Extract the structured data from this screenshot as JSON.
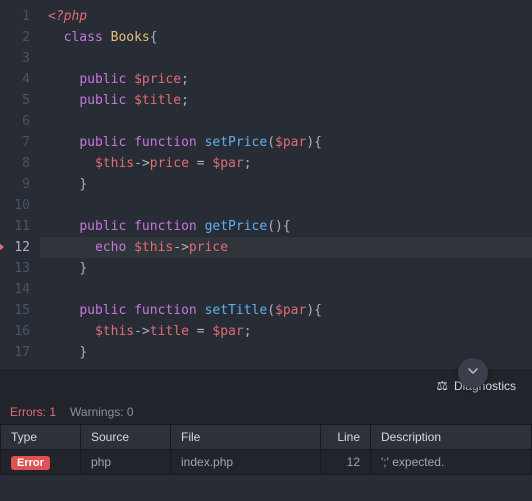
{
  "editor": {
    "lines": [
      {
        "n": 1,
        "indent": 0,
        "tokens": [
          {
            "t": "<?php",
            "c": "t-php"
          }
        ]
      },
      {
        "n": 2,
        "indent": 1,
        "tokens": [
          {
            "t": "class ",
            "c": "t-kw"
          },
          {
            "t": "Books",
            "c": "t-cls"
          },
          {
            "t": "{",
            "c": "t-punc"
          }
        ]
      },
      {
        "n": 3,
        "indent": 0,
        "tokens": []
      },
      {
        "n": 4,
        "indent": 2,
        "tokens": [
          {
            "t": "public ",
            "c": "t-kw"
          },
          {
            "t": "$price",
            "c": "t-var"
          },
          {
            "t": ";",
            "c": "t-punc"
          }
        ]
      },
      {
        "n": 5,
        "indent": 2,
        "tokens": [
          {
            "t": "public ",
            "c": "t-kw"
          },
          {
            "t": "$title",
            "c": "t-var"
          },
          {
            "t": ";",
            "c": "t-punc"
          }
        ]
      },
      {
        "n": 6,
        "indent": 0,
        "tokens": []
      },
      {
        "n": 7,
        "indent": 2,
        "tokens": [
          {
            "t": "public ",
            "c": "t-kw"
          },
          {
            "t": "function ",
            "c": "t-kw"
          },
          {
            "t": "setPrice",
            "c": "t-fn"
          },
          {
            "t": "(",
            "c": "t-punc"
          },
          {
            "t": "$par",
            "c": "t-var"
          },
          {
            "t": "){",
            "c": "t-punc"
          }
        ]
      },
      {
        "n": 8,
        "indent": 3,
        "tokens": [
          {
            "t": "$this",
            "c": "t-this"
          },
          {
            "t": "->",
            "c": "t-op"
          },
          {
            "t": "price",
            "c": "t-prop"
          },
          {
            "t": " = ",
            "c": "t-op"
          },
          {
            "t": "$par",
            "c": "t-var"
          },
          {
            "t": ";",
            "c": "t-punc"
          }
        ]
      },
      {
        "n": 9,
        "indent": 2,
        "tokens": [
          {
            "t": "}",
            "c": "t-punc"
          }
        ]
      },
      {
        "n": 10,
        "indent": 0,
        "tokens": []
      },
      {
        "n": 11,
        "indent": 2,
        "tokens": [
          {
            "t": "public ",
            "c": "t-kw"
          },
          {
            "t": "function ",
            "c": "t-kw"
          },
          {
            "t": "getPrice",
            "c": "t-fn"
          },
          {
            "t": "(){",
            "c": "t-punc"
          }
        ]
      },
      {
        "n": 12,
        "indent": 3,
        "current": true,
        "marker": true,
        "tokens": [
          {
            "t": "echo ",
            "c": "t-echo"
          },
          {
            "t": "$this",
            "c": "t-this"
          },
          {
            "t": "->",
            "c": "t-op"
          },
          {
            "t": "price",
            "c": "t-prop"
          }
        ]
      },
      {
        "n": 13,
        "indent": 2,
        "tokens": [
          {
            "t": "}",
            "c": "t-punc"
          }
        ]
      },
      {
        "n": 14,
        "indent": 0,
        "tokens": []
      },
      {
        "n": 15,
        "indent": 2,
        "tokens": [
          {
            "t": "public ",
            "c": "t-kw"
          },
          {
            "t": "function ",
            "c": "t-kw"
          },
          {
            "t": "setTitle",
            "c": "t-fn"
          },
          {
            "t": "(",
            "c": "t-punc"
          },
          {
            "t": "$par",
            "c": "t-var"
          },
          {
            "t": "){",
            "c": "t-punc"
          }
        ]
      },
      {
        "n": 16,
        "indent": 3,
        "tokens": [
          {
            "t": "$this",
            "c": "t-this"
          },
          {
            "t": "->",
            "c": "t-op"
          },
          {
            "t": "title",
            "c": "t-prop"
          },
          {
            "t": " = ",
            "c": "t-op"
          },
          {
            "t": "$par",
            "c": "t-var"
          },
          {
            "t": ";",
            "c": "t-punc"
          }
        ]
      },
      {
        "n": 17,
        "indent": 2,
        "tokens": [
          {
            "t": "}",
            "c": "t-punc"
          }
        ]
      }
    ]
  },
  "diagnostics": {
    "title": "Diagnostics",
    "summary": {
      "errors_label": "Errors: 1",
      "warnings_label": "Warnings: 0"
    },
    "columns": {
      "type": "Type",
      "source": "Source",
      "file": "File",
      "line": "Line",
      "description": "Description"
    },
    "rows": [
      {
        "type": "Error",
        "source": "php",
        "file": "index.php",
        "line": "12",
        "description": "';' expected."
      }
    ]
  }
}
